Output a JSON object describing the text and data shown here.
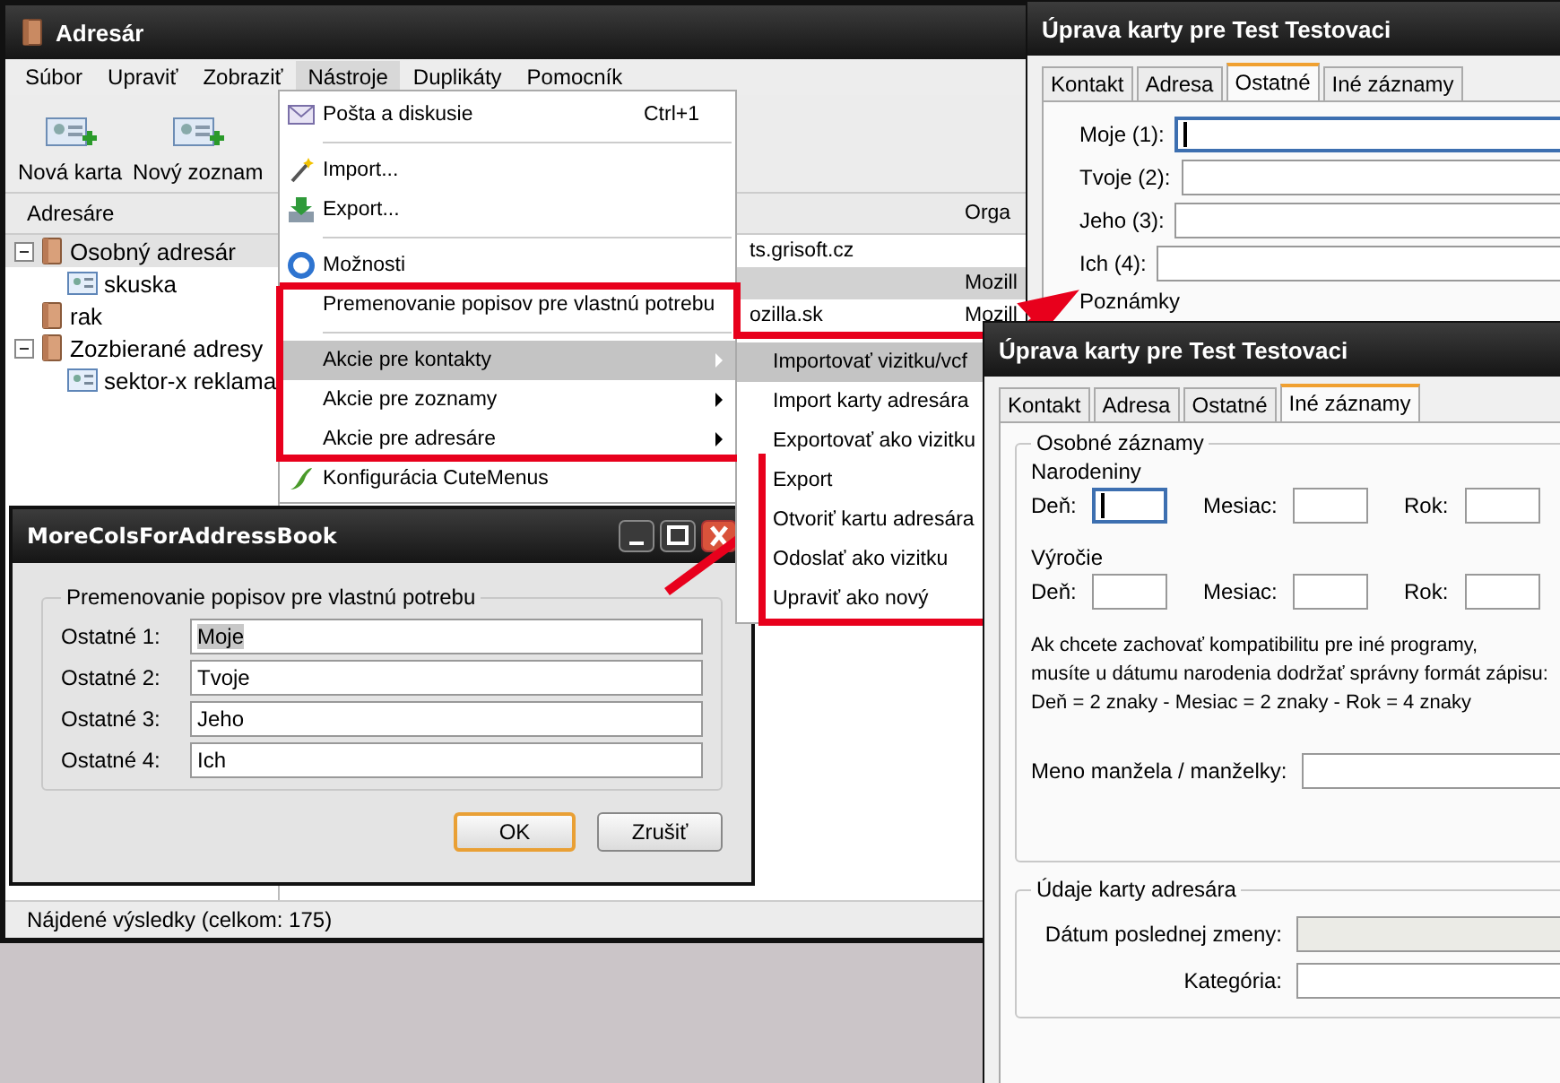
{
  "main_window": {
    "title": "Adresár",
    "menu": [
      {
        "label": "Súbor",
        "selected": false
      },
      {
        "label": "Upraviť",
        "selected": false
      },
      {
        "label": "Zobraziť",
        "selected": false
      },
      {
        "label": "Nástroje",
        "selected": true
      },
      {
        "label": "Duplikáty",
        "selected": false
      },
      {
        "label": "Pomocník",
        "selected": false
      }
    ],
    "toolbar": [
      {
        "label": "Nová karta"
      },
      {
        "label": "Nový zoznam"
      }
    ],
    "sidebar": {
      "header": "Adresáre",
      "tree": [
        {
          "label": "Osobný adresár",
          "selected": true,
          "expanded": true,
          "children": [
            {
              "label": "skuska",
              "selected": false
            }
          ]
        },
        {
          "label": "rak",
          "selected": false
        },
        {
          "label": "Zozbierané adresy",
          "selected": false,
          "expanded": true,
          "children": [
            {
              "label": "sektor-x reklama",
              "selected": false
            }
          ]
        }
      ]
    },
    "list": {
      "column_2": "Orga",
      "rows": [
        {
          "column_1": "ts.grisoft.cz",
          "selected": false
        },
        {
          "column_2": "Mozill",
          "selected": true
        },
        {
          "column_1": "ozilla.sk",
          "column_2": "Mozill",
          "selected": false
        }
      ]
    },
    "status": "Nájdené výsledky (celkom: 175)"
  },
  "tools_menu": {
    "items": [
      {
        "kind": "item",
        "label": "Pošta a diskusie",
        "shortcut": "Ctrl+1",
        "selected": false
      },
      {
        "kind": "separator"
      },
      {
        "kind": "item",
        "label": "Import...",
        "selected": false
      },
      {
        "kind": "item",
        "label": "Export...",
        "selected": false
      },
      {
        "kind": "separator"
      },
      {
        "kind": "item",
        "label": "Možnosti",
        "selected": false
      },
      {
        "kind": "item",
        "label": "Premenovanie popisov pre vlastnú potrebu",
        "selected": false
      },
      {
        "kind": "separator"
      },
      {
        "kind": "submenu",
        "label": "Akcie pre kontakty",
        "selected": true
      },
      {
        "kind": "submenu",
        "label": "Akcie pre zoznamy",
        "selected": false
      },
      {
        "kind": "submenu",
        "label": "Akcie pre adresáre",
        "selected": false
      },
      {
        "kind": "item",
        "label": "Konfigurácia CuteMenus",
        "selected": false
      }
    ]
  },
  "contacts_submenu": {
    "items": [
      {
        "label": "Importovať vizitku/vcf",
        "selected": true
      },
      {
        "label": "Import karty adresára",
        "selected": false
      },
      {
        "label": "Exportovať ako vizitku",
        "selected": false
      },
      {
        "label": "Export",
        "selected": false
      },
      {
        "label": "Otvoriť kartu adresára",
        "selected": false
      },
      {
        "label": "Odoslať ako vizitku",
        "selected": false
      },
      {
        "label": "Upraviť ako nový",
        "selected": false
      }
    ]
  },
  "rename_dialog": {
    "title": "MoreColsForAddressBook",
    "group": "Premenovanie popisov pre vlastnú potrebu",
    "fields": [
      {
        "label": "Ostatné 1:",
        "value": "Moje",
        "highlighted": true
      },
      {
        "label": "Ostatné 2:",
        "value": "Tvoje",
        "highlighted": false
      },
      {
        "label": "Ostatné 3:",
        "value": "Jeho",
        "highlighted": false
      },
      {
        "label": "Ostatné 4:",
        "value": "Ich",
        "highlighted": false
      }
    ],
    "buttons": [
      {
        "label": "OK",
        "default": true
      },
      {
        "label": "Zrušiť",
        "default": false
      }
    ]
  },
  "card_window_back": {
    "title": "Úprava karty pre Test Testovaci",
    "tabs": [
      {
        "label": "Kontakt",
        "selected": false
      },
      {
        "label": "Adresa",
        "selected": false
      },
      {
        "label": "Ostatné",
        "selected": true
      },
      {
        "label": "Iné záznamy",
        "selected": false
      }
    ],
    "fields": [
      {
        "label": "Moje  (1):",
        "focused": true
      },
      {
        "label": "Tvoje  (2):",
        "focused": false
      },
      {
        "label": "Jeho  (3):",
        "focused": false
      },
      {
        "label": "Ich  (4):",
        "focused": false
      }
    ],
    "notes_group": "Poznámky"
  },
  "card_window_front": {
    "title": "Úprava karty pre Test Testovaci",
    "tabs": [
      {
        "label": "Kontakt",
        "selected": false
      },
      {
        "label": "Adresa",
        "selected": false
      },
      {
        "label": "Ostatné",
        "selected": false
      },
      {
        "label": "Iné záznamy",
        "selected": true
      }
    ],
    "personal_group": "Osobné záznamy",
    "dates": [
      {
        "title": "Narodeniny",
        "fields": [
          {
            "label": "Deň:",
            "focused": true
          },
          {
            "label": "Mesiac:",
            "focused": false
          },
          {
            "label": "Rok:",
            "focused": false
          }
        ]
      },
      {
        "title": "Výročie",
        "fields": [
          {
            "label": "Deň:",
            "focused": false
          },
          {
            "label": "Mesiac:",
            "focused": false
          },
          {
            "label": "Rok:",
            "focused": false
          }
        ]
      }
    ],
    "note": [
      "Ak chcete zachovať kompatibilitu pre iné programy,",
      "musíte u dátumu narodenia dodržať správny formát zápisu:",
      "Deň = 2 znaky  -  Mesiac = 2 znaky  -  Rok = 4 znaky"
    ],
    "spouse_label": "Meno manžela / manželky:",
    "card_group": "Údaje karty adresára",
    "card_fields": [
      {
        "label": "Dátum poslednej zmeny:",
        "disabled": true
      },
      {
        "label": "Kategória:",
        "disabled": false
      }
    ]
  }
}
